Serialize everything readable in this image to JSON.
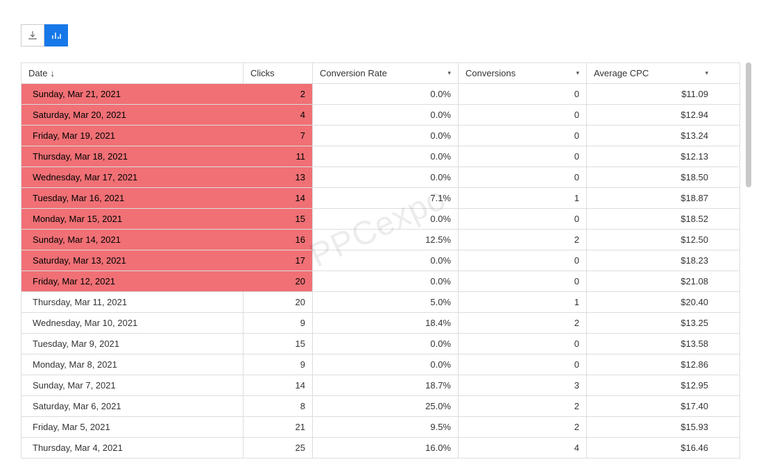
{
  "watermark": "PPCexpo",
  "toolbar": {
    "download_icon": "download-icon",
    "chart_icon": "bar-chart-icon"
  },
  "headers": {
    "date": "Date",
    "clicks": "Clicks",
    "conversion_rate": "Conversion Rate",
    "conversions": "Conversions",
    "average_cpc": "Average CPC"
  },
  "rows": [
    {
      "hl": true,
      "date": "Sunday, Mar 21, 2021",
      "clicks": "2",
      "conversion_rate": "0.0%",
      "conversions": "0",
      "avg_cpc": "$11.09"
    },
    {
      "hl": true,
      "date": "Saturday, Mar 20, 2021",
      "clicks": "4",
      "conversion_rate": "0.0%",
      "conversions": "0",
      "avg_cpc": "$12.94"
    },
    {
      "hl": true,
      "date": "Friday, Mar 19, 2021",
      "clicks": "7",
      "conversion_rate": "0.0%",
      "conversions": "0",
      "avg_cpc": "$13.24"
    },
    {
      "hl": true,
      "date": "Thursday, Mar 18, 2021",
      "clicks": "11",
      "conversion_rate": "0.0%",
      "conversions": "0",
      "avg_cpc": "$12.13"
    },
    {
      "hl": true,
      "date": "Wednesday, Mar 17, 2021",
      "clicks": "13",
      "conversion_rate": "0.0%",
      "conversions": "0",
      "avg_cpc": "$18.50"
    },
    {
      "hl": true,
      "date": "Tuesday, Mar 16, 2021",
      "clicks": "14",
      "conversion_rate": "7.1%",
      "conversions": "1",
      "avg_cpc": "$18.87"
    },
    {
      "hl": true,
      "date": "Monday, Mar 15, 2021",
      "clicks": "15",
      "conversion_rate": "0.0%",
      "conversions": "0",
      "avg_cpc": "$18.52"
    },
    {
      "hl": true,
      "date": "Sunday, Mar 14, 2021",
      "clicks": "16",
      "conversion_rate": "12.5%",
      "conversions": "2",
      "avg_cpc": "$12.50"
    },
    {
      "hl": true,
      "date": "Saturday, Mar 13, 2021",
      "clicks": "17",
      "conversion_rate": "0.0%",
      "conversions": "0",
      "avg_cpc": "$18.23"
    },
    {
      "hl": true,
      "date": "Friday, Mar 12, 2021",
      "clicks": "20",
      "conversion_rate": "0.0%",
      "conversions": "0",
      "avg_cpc": "$21.08"
    },
    {
      "hl": false,
      "date": "Thursday, Mar 11, 2021",
      "clicks": "20",
      "conversion_rate": "5.0%",
      "conversions": "1",
      "avg_cpc": "$20.40"
    },
    {
      "hl": false,
      "date": "Wednesday, Mar 10, 2021",
      "clicks": "9",
      "conversion_rate": "18.4%",
      "conversions": "2",
      "avg_cpc": "$13.25"
    },
    {
      "hl": false,
      "date": "Tuesday, Mar 9, 2021",
      "clicks": "15",
      "conversion_rate": "0.0%",
      "conversions": "0",
      "avg_cpc": "$13.58"
    },
    {
      "hl": false,
      "date": "Monday, Mar 8, 2021",
      "clicks": "9",
      "conversion_rate": "0.0%",
      "conversions": "0",
      "avg_cpc": "$12.86"
    },
    {
      "hl": false,
      "date": "Sunday, Mar 7, 2021",
      "clicks": "14",
      "conversion_rate": "18.7%",
      "conversions": "3",
      "avg_cpc": "$12.95"
    },
    {
      "hl": false,
      "date": "Saturday, Mar 6, 2021",
      "clicks": "8",
      "conversion_rate": "25.0%",
      "conversions": "2",
      "avg_cpc": "$17.40"
    },
    {
      "hl": false,
      "date": "Friday, Mar 5, 2021",
      "clicks": "21",
      "conversion_rate": "9.5%",
      "conversions": "2",
      "avg_cpc": "$15.93"
    },
    {
      "hl": false,
      "date": "Thursday, Mar 4, 2021",
      "clicks": "25",
      "conversion_rate": "16.0%",
      "conversions": "4",
      "avg_cpc": "$16.46"
    }
  ],
  "chart_data": {
    "type": "table",
    "columns": [
      "Date",
      "Clicks",
      "Conversion Rate",
      "Conversions",
      "Average CPC"
    ],
    "data": [
      [
        "Sunday, Mar 21, 2021",
        2,
        0.0,
        0,
        11.09
      ],
      [
        "Saturday, Mar 20, 2021",
        4,
        0.0,
        0,
        12.94
      ],
      [
        "Friday, Mar 19, 2021",
        7,
        0.0,
        0,
        13.24
      ],
      [
        "Thursday, Mar 18, 2021",
        11,
        0.0,
        0,
        12.13
      ],
      [
        "Wednesday, Mar 17, 2021",
        13,
        0.0,
        0,
        18.5
      ],
      [
        "Tuesday, Mar 16, 2021",
        14,
        7.1,
        1,
        18.87
      ],
      [
        "Monday, Mar 15, 2021",
        15,
        0.0,
        0,
        18.52
      ],
      [
        "Sunday, Mar 14, 2021",
        16,
        12.5,
        2,
        12.5
      ],
      [
        "Saturday, Mar 13, 2021",
        17,
        0.0,
        0,
        18.23
      ],
      [
        "Friday, Mar 12, 2021",
        20,
        0.0,
        0,
        21.08
      ],
      [
        "Thursday, Mar 11, 2021",
        20,
        5.0,
        1,
        20.4
      ],
      [
        "Wednesday, Mar 10, 2021",
        9,
        18.4,
        2,
        13.25
      ],
      [
        "Tuesday, Mar 9, 2021",
        15,
        0.0,
        0,
        13.58
      ],
      [
        "Monday, Mar 8, 2021",
        9,
        0.0,
        0,
        12.86
      ],
      [
        "Sunday, Mar 7, 2021",
        14,
        18.7,
        3,
        12.95
      ],
      [
        "Saturday, Mar 6, 2021",
        8,
        25.0,
        2,
        17.4
      ],
      [
        "Friday, Mar 5, 2021",
        21,
        9.5,
        2,
        15.93
      ],
      [
        "Thursday, Mar 4, 2021",
        25,
        16.0,
        4,
        16.46
      ]
    ]
  }
}
